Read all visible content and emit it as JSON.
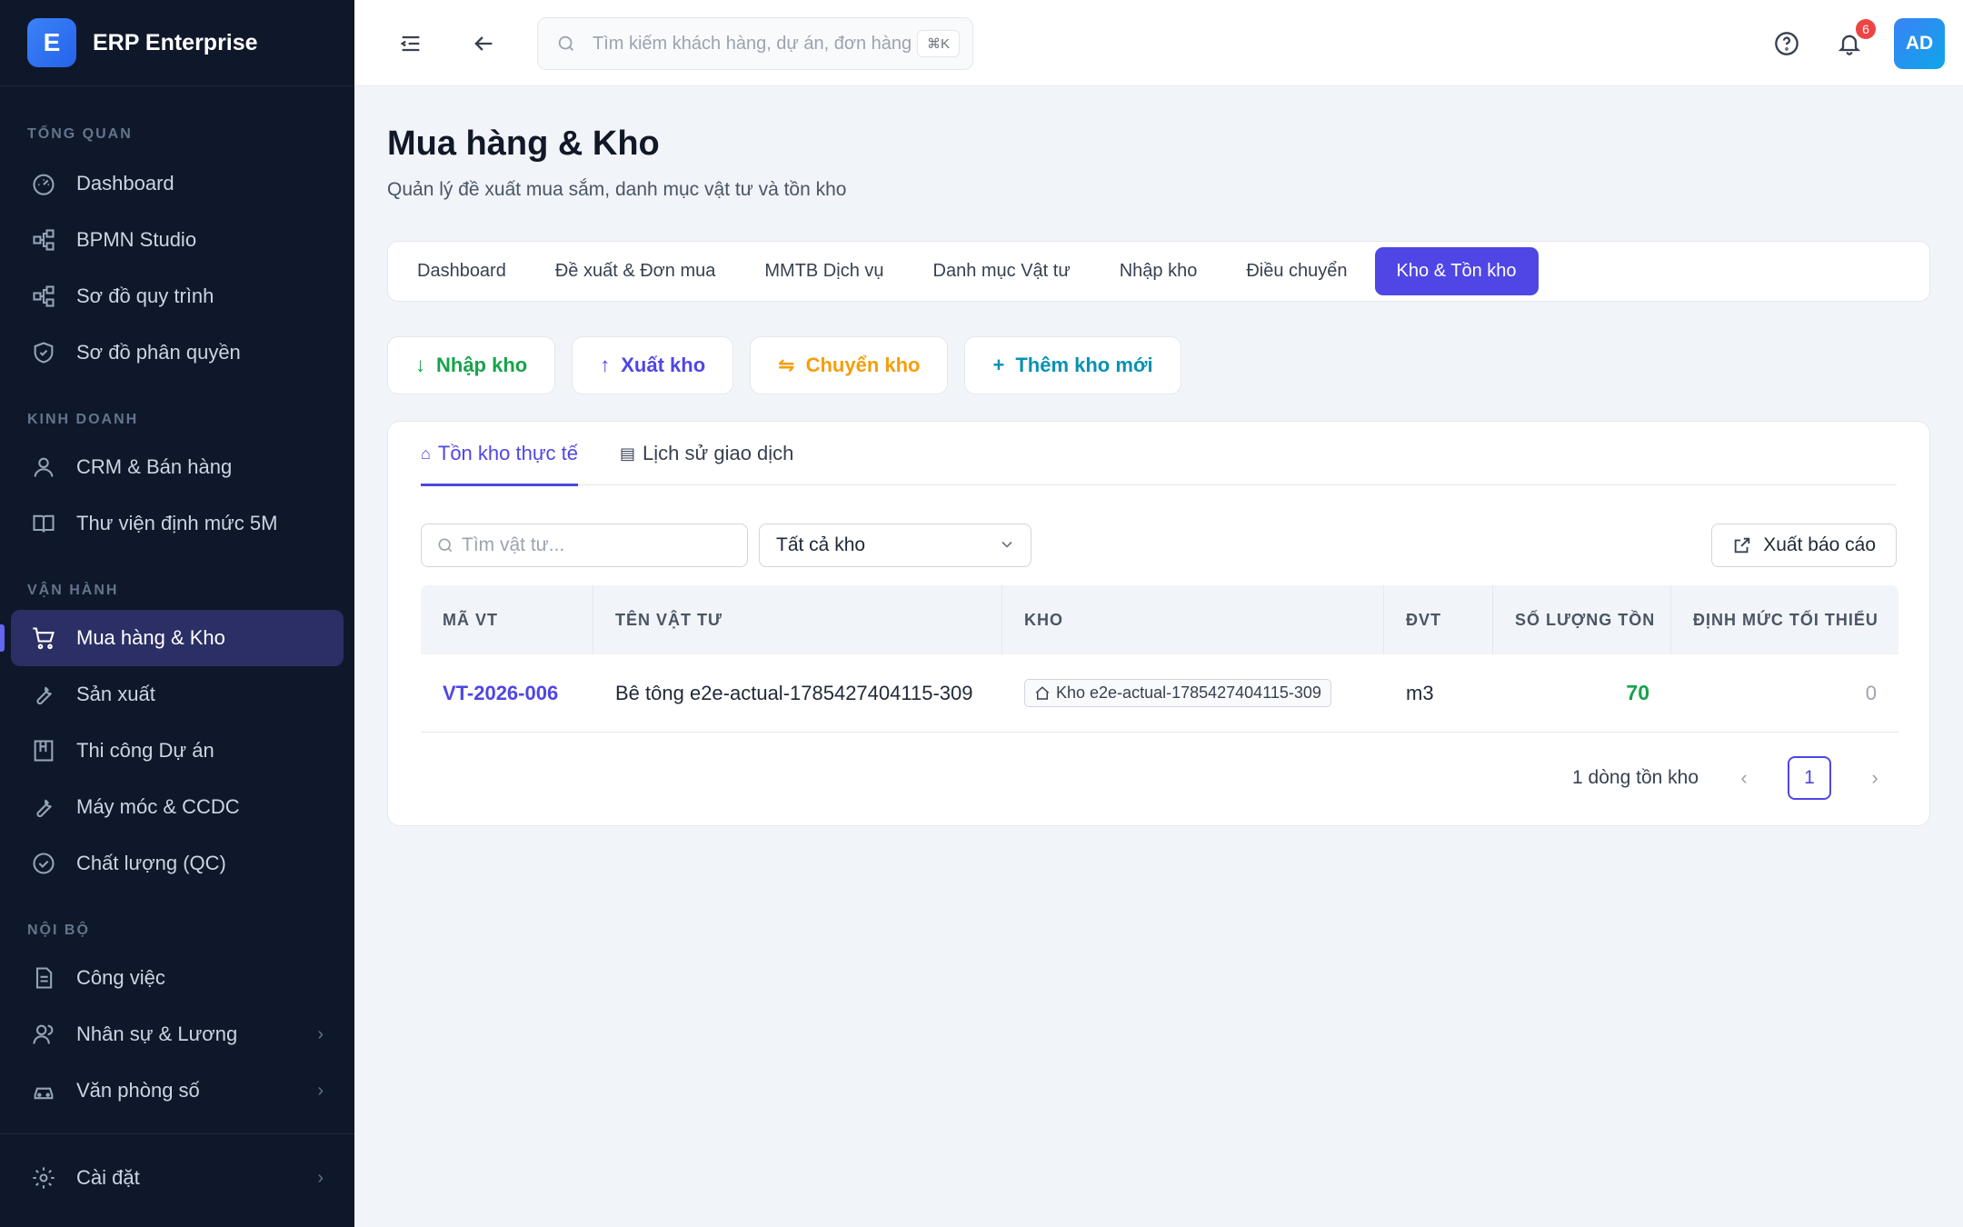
{
  "brand": {
    "logo_letter": "E",
    "name": "ERP Enterprise"
  },
  "sidebar": {
    "sections": [
      {
        "title": "TỔNG QUAN",
        "items": [
          {
            "label": "Dashboard",
            "icon": "gauge-icon"
          },
          {
            "label": "BPMN Studio",
            "icon": "workflow-icon"
          },
          {
            "label": "Sơ đồ quy trình",
            "icon": "workflow-icon"
          },
          {
            "label": "Sơ đồ phân quyền",
            "icon": "shield-icon"
          }
        ]
      },
      {
        "title": "KINH DOANH",
        "items": [
          {
            "label": "CRM & Bán hàng",
            "icon": "user-icon"
          },
          {
            "label": "Thư viện định mức 5M",
            "icon": "book-icon"
          }
        ]
      },
      {
        "title": "VẬN HÀNH",
        "items": [
          {
            "label": "Mua hàng & Kho",
            "icon": "cart-icon",
            "active": true
          },
          {
            "label": "Sản xuất",
            "icon": "wrench-icon"
          },
          {
            "label": "Thi công Dự án",
            "icon": "building-icon"
          },
          {
            "label": "Máy móc & CCDC",
            "icon": "wrench-icon"
          },
          {
            "label": "Chất lượng (QC)",
            "icon": "check-circle-icon"
          }
        ]
      },
      {
        "title": "NỘI BỘ",
        "items": [
          {
            "label": "Công việc",
            "icon": "document-icon"
          },
          {
            "label": "Nhân sự & Lương",
            "icon": "users-icon",
            "chevron": true
          },
          {
            "label": "Văn phòng số",
            "icon": "car-icon",
            "chevron": true
          }
        ]
      }
    ],
    "footer": {
      "label": "Cài đặt",
      "icon": "gear-icon"
    }
  },
  "header": {
    "search_placeholder": "Tìm kiếm khách hàng, dự án, đơn hàng...",
    "shortcut": "⌘K",
    "notifications_count": "6",
    "avatar_initials": "AD"
  },
  "page": {
    "title": "Mua hàng & Kho",
    "subtitle": "Quản lý đề xuất mua sắm, danh mục vật tư và tồn kho"
  },
  "tabs": [
    {
      "label": "Dashboard"
    },
    {
      "label": "Đề xuất & Đơn mua"
    },
    {
      "label": "MMTB Dịch vụ"
    },
    {
      "label": "Danh mục Vật tư"
    },
    {
      "label": "Nhập kho"
    },
    {
      "label": "Điều chuyển"
    },
    {
      "label": "Kho & Tồn kho",
      "active": true
    }
  ],
  "actions": {
    "import": "Nhập kho",
    "export": "Xuất kho",
    "transfer": "Chuyển kho",
    "add": "Thêm kho mới"
  },
  "subtabs": {
    "stock": "Tồn kho thực tế",
    "history": "Lịch sử giao dịch"
  },
  "filters": {
    "search_placeholder": "Tìm vật tư...",
    "warehouse_selected": "Tất cả kho",
    "export_report": "Xuất báo cáo"
  },
  "table": {
    "headers": [
      "MÃ VT",
      "TÊN VẬT TƯ",
      "KHO",
      "ĐVT",
      "SỐ LƯỢNG TỒN",
      "ĐỊNH MỨC TỐI THIỂU"
    ],
    "rows": [
      {
        "code": "VT-2026-006",
        "name": "Bê tông e2e-actual-1785427404115-309",
        "warehouse": "Kho e2e-actual-1785427404115-309",
        "unit": "m3",
        "qty": "70",
        "min": "0"
      }
    ]
  },
  "pagination": {
    "total_text": "1 dòng tồn kho",
    "current_page": "1"
  },
  "colors": {
    "primary": "#4f46e5",
    "sidebar_bg": "#0f172a",
    "success": "#16a34a",
    "warning": "#f59e0b",
    "info": "#0891b2"
  }
}
